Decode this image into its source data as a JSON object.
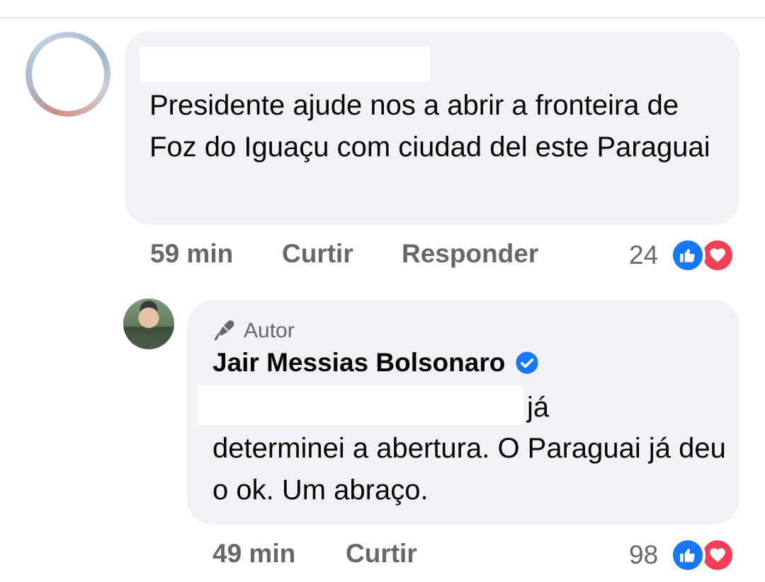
{
  "comment": {
    "text": "Presidente ajude nos a abrir a fronteira de Foz do Iguaçu com ciudad del este Paraguai",
    "time": "59 min",
    "like_label": "Curtir",
    "reply_label": "Responder",
    "reaction_count": "24"
  },
  "reply": {
    "badge_label": "Autor",
    "author_name": "Jair Messias Bolsonaro",
    "text_first": "já",
    "text_rest": "determinei a abertura. O Paraguai já deu o ok. Um abraço.",
    "time": "49 min",
    "like_label": "Curtir",
    "reaction_count": "98"
  },
  "colors": {
    "bubble": "#f0f2f5",
    "meta_text": "#65676b",
    "like_blue": "#1877f2",
    "love_red": "#f33e58"
  },
  "icons": [
    "like-icon",
    "love-icon",
    "verified-badge-icon",
    "microphone-icon"
  ]
}
